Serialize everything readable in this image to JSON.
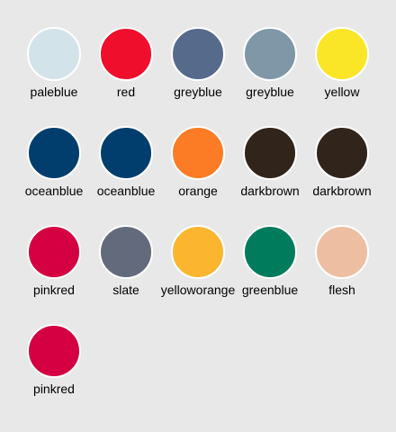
{
  "swatches": [
    {
      "label": "paleblue",
      "color": "#d3e3ea"
    },
    {
      "label": "red",
      "color": "#ef0e2b"
    },
    {
      "label": "greyblue",
      "color": "#566a8c"
    },
    {
      "label": "greyblue",
      "color": "#7f97a7"
    },
    {
      "label": "yellow",
      "color": "#fae626"
    },
    {
      "label": "oceanblue",
      "color": "#013e6e"
    },
    {
      "label": "oceanblue",
      "color": "#013e6e"
    },
    {
      "label": "orange",
      "color": "#fc7b25"
    },
    {
      "label": "darkbrown",
      "color": "#31241b"
    },
    {
      "label": "darkbrown",
      "color": "#31241b"
    },
    {
      "label": "pinkred",
      "color": "#d40041"
    },
    {
      "label": "slate",
      "color": "#626a7b"
    },
    {
      "label": "yelloworange",
      "color": "#fcb52e"
    },
    {
      "label": "greenblue",
      "color": "#007c5d"
    },
    {
      "label": "flesh",
      "color": "#eebea2"
    },
    {
      "label": "pinkred",
      "color": "#d40041"
    }
  ]
}
